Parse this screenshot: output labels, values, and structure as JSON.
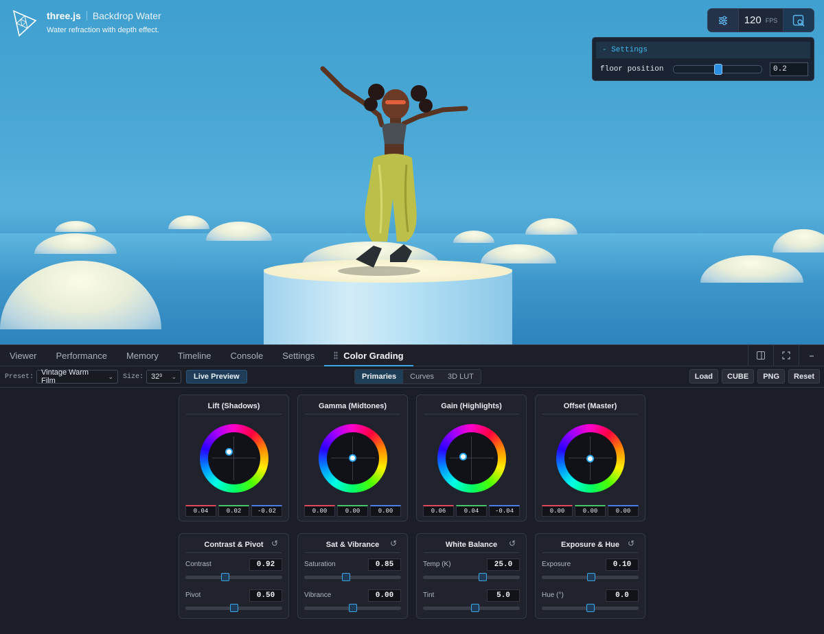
{
  "brand": {
    "name": "three.js",
    "title": "Backdrop Water",
    "description": "Water refraction with depth effect."
  },
  "fps": {
    "value": "120",
    "unit": "FPS"
  },
  "gui": {
    "title": "- Settings",
    "label": "floor position",
    "value": "0.2",
    "level": 0.5
  },
  "tabs": [
    {
      "label": "Viewer"
    },
    {
      "label": "Performance"
    },
    {
      "label": "Memory"
    },
    {
      "label": "Timeline"
    },
    {
      "label": "Console"
    },
    {
      "label": "Settings"
    },
    {
      "label": "Color Grading"
    }
  ],
  "toolbar": {
    "preset_label": "Preset:",
    "preset_value": "Vintage Warm Film",
    "size_label": "Size:",
    "size_value": "32³",
    "live_preview": "Live Preview",
    "modes": [
      "Primaries",
      "Curves",
      "3D LUT"
    ],
    "actions": [
      "Load",
      "CUBE",
      "PNG",
      "Reset"
    ]
  },
  "wheels": [
    {
      "title": "Lift (Shadows)",
      "values": [
        "0.04",
        "0.02",
        "-0.02"
      ]
    },
    {
      "title": "Gamma (Midtones)",
      "values": [
        "0.00",
        "0.00",
        "0.00"
      ]
    },
    {
      "title": "Gain (Highlights)",
      "values": [
        "0.06",
        "0.04",
        "-0.04"
      ]
    },
    {
      "title": "Offset (Master)",
      "values": [
        "0.00",
        "0.00",
        "0.00"
      ]
    }
  ],
  "slider_cards": [
    {
      "title": "Contrast & Pivot",
      "reset": "↺",
      "rows": [
        {
          "label": "Contrast",
          "value": "0.92",
          "level": 0.41
        },
        {
          "label": "Pivot",
          "value": "0.50",
          "level": 0.5
        }
      ]
    },
    {
      "title": "Sat & Vibrance",
      "reset": "↺",
      "rows": [
        {
          "label": "Saturation",
          "value": "0.85",
          "level": 0.43
        },
        {
          "label": "Vibrance",
          "value": "0.00",
          "level": 0.5
        }
      ]
    },
    {
      "title": "White Balance",
      "reset": "↺",
      "rows": [
        {
          "label": "Temp (K)",
          "value": "25.0",
          "level": 0.62
        },
        {
          "label": "Tint",
          "value": "5.0",
          "level": 0.54
        }
      ]
    },
    {
      "title": "Exposure & Hue",
      "reset": "↺",
      "rows": [
        {
          "label": "Exposure",
          "value": "0.10",
          "level": 0.51
        },
        {
          "label": "Hue (°)",
          "value": "0.0",
          "level": 0.5
        }
      ]
    }
  ],
  "icons": {
    "settings": "sliders-icon",
    "inspect": "inspect-icon",
    "split": "split-view-icon",
    "fullscreen": "fullscreen-icon",
    "minimize": "minimize-icon",
    "reset": "reset-icon"
  },
  "colors": {
    "accent": "#3aa7e6",
    "panel_bg": "#1c1e27",
    "sky": "#4eaad6"
  }
}
